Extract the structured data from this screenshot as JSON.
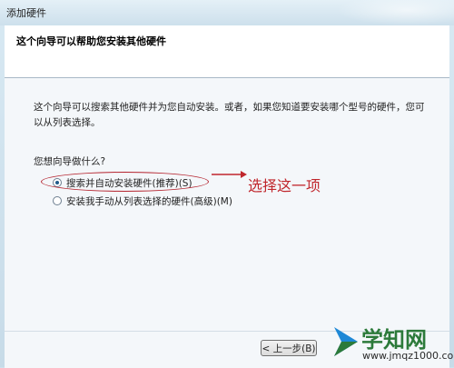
{
  "window": {
    "title": "添加硬件"
  },
  "header": {
    "heading": "这个向导可以帮助您安装其他硬件"
  },
  "body": {
    "description": "这个向导可以搜索其他硬件并为您自动安装。或者，如果您知道要安装哪个型号的硬件，您可以从列表选择。",
    "question": "您想向导做什么?",
    "options": [
      {
        "label": "搜索并自动安装硬件(推荐)(S)",
        "selected": true
      },
      {
        "label": "安装我手动从列表选择的硬件(高级)(M)",
        "selected": false
      }
    ]
  },
  "annotation": {
    "text": "选择这一项",
    "color": "#c0262c"
  },
  "footer": {
    "back_label": "< 上一步(B)"
  },
  "watermark": {
    "logo_text": "学知网",
    "url": "www.jmqz1000.com"
  }
}
